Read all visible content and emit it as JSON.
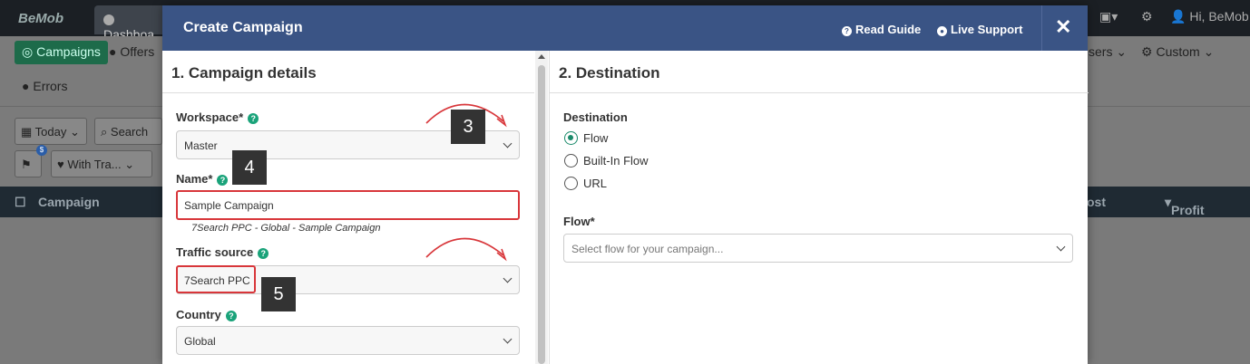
{
  "app": {
    "logo": "BeMob",
    "tab_label": "Dashboa",
    "user_greeting": "Hi, BeMob"
  },
  "nav": {
    "campaigns": "Campaigns",
    "offers": "Offers",
    "errors": "Errors",
    "owners_partial": "sers",
    "custom": "Custom"
  },
  "toolbar": {
    "date": "Today",
    "search_placeholder": "Search",
    "filter_label": "With Tra...",
    "badge": "$"
  },
  "table": {
    "col_campaign": "Campaign",
    "col_cost_partial": "ost",
    "col_profit": "Profit"
  },
  "modal": {
    "title": "Create Campaign",
    "read_guide": "Read Guide",
    "live_support": "Live Support",
    "close": "✕"
  },
  "details": {
    "title": "1. Campaign details",
    "workspace_label": "Workspace*",
    "workspace_value": "Master",
    "name_label": "Name*",
    "name_value": "Sample Campaign",
    "name_hint": "7Search PPC - Global - Sample Campaign",
    "traffic_label": "Traffic source",
    "traffic_value": "7Search PPC",
    "country_label": "Country",
    "country_value": "Global"
  },
  "destination": {
    "title": "2. Destination",
    "label": "Destination",
    "options": [
      "Flow",
      "Built-In Flow",
      "URL"
    ],
    "selected": "Flow",
    "flow_label": "Flow*",
    "flow_placeholder": "Select flow for your campaign..."
  },
  "callouts": {
    "three": "3",
    "four": "4",
    "five": "5"
  },
  "colors": {
    "header": "#3a5485",
    "accent_green": "#1aa37a",
    "highlight_red": "#d8363a"
  }
}
